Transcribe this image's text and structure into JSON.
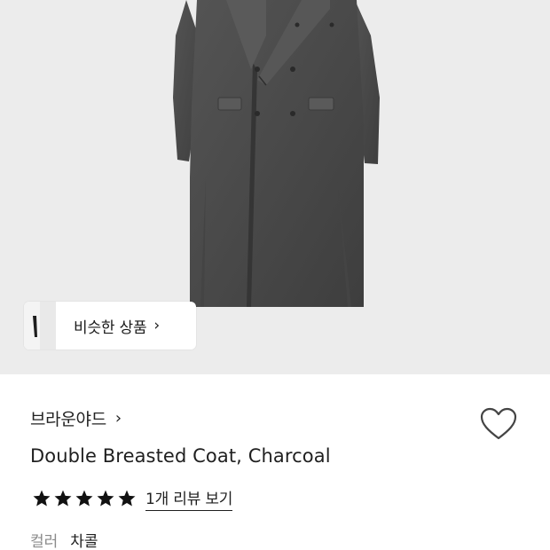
{
  "product_image": {
    "icon": "coat-image",
    "background": "#ececec",
    "coat_color": "#4a4a4a"
  },
  "similar": {
    "label": "비슷한 상품",
    "chevron": "›"
  },
  "brand": {
    "name": "브라운야드",
    "chevron": "›"
  },
  "wishlist": {
    "icon": "heart-outline-icon"
  },
  "product": {
    "title": "Double Breasted Coat, Charcoal"
  },
  "rating": {
    "stars": 5,
    "max_stars": 5,
    "review_link": "1개 리뷰 보기"
  },
  "option": {
    "key": "컬러",
    "value": "차콜"
  }
}
